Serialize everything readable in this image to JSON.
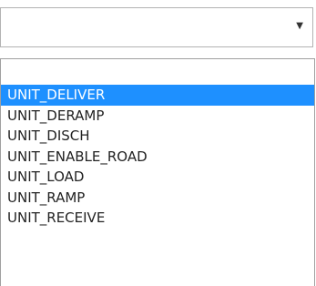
{
  "select": {
    "value": "",
    "icon": "chevron-down-icon",
    "chevron_glyph": "▼"
  },
  "dropdown": {
    "selected_index": 0,
    "selected_color": "#1e90ff",
    "options": [
      "UNIT_DELIVER",
      "UNIT_DERAMP",
      "UNIT_DISCH",
      "UNIT_ENABLE_ROAD",
      "UNIT_LOAD",
      "UNIT_RAMP",
      "UNIT_RECEIVE"
    ]
  }
}
